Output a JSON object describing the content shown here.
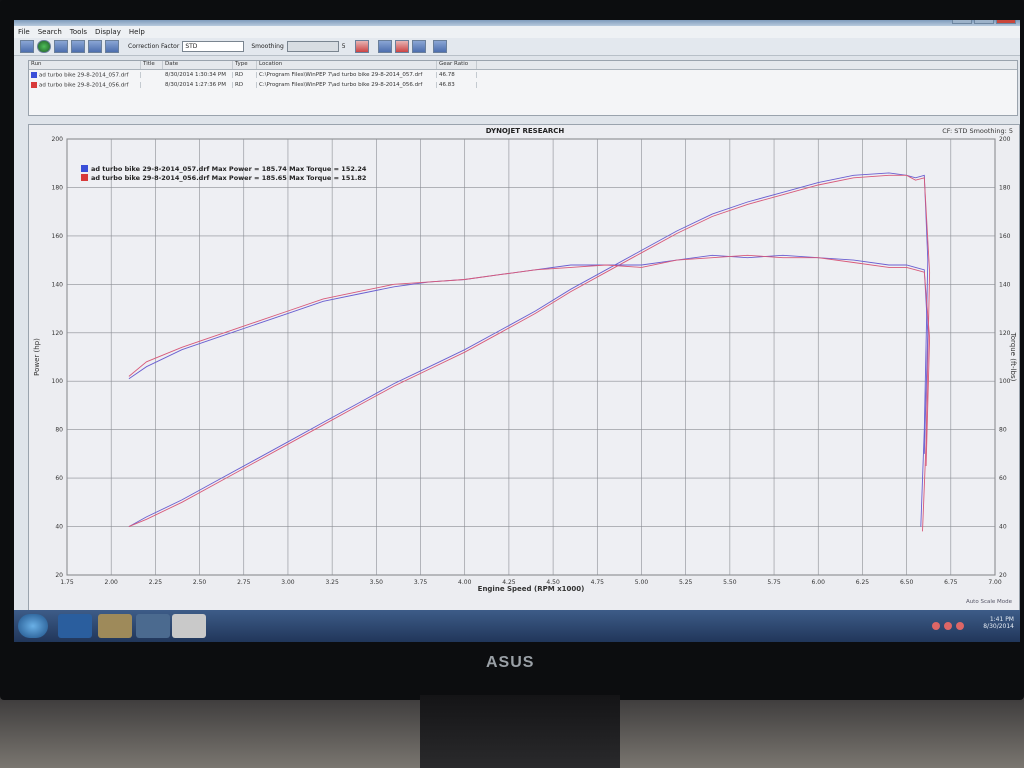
{
  "menu": [
    "File",
    "Search",
    "Tools",
    "Display",
    "Help"
  ],
  "toolbar": {
    "correction_factor_label": "Correction Factor",
    "correction_factor_value": "STD",
    "smoothing_label": "Smoothing",
    "smoothing_value": "5"
  },
  "runs": {
    "columns": [
      "Run",
      "Title",
      "Date",
      "Type",
      "Location",
      "Gear Ratio"
    ],
    "rows": [
      {
        "run": "ad turbo bike 29-8-2014_057.drf",
        "title": "",
        "date": "8/30/2014 1:30:34 PM",
        "type": "RD",
        "location": "C:\\Program Files\\WinPEP 7\\ad turbo bike 29-8-2014_057.drf",
        "gear": "46.78",
        "color": "#3a4fd8"
      },
      {
        "run": "ad turbo bike 29-8-2014_056.drf",
        "title": "",
        "date": "8/30/2014 1:27:36 PM",
        "type": "RD",
        "location": "C:\\Program Files\\WinPEP 7\\ad turbo bike 29-8-2014_056.drf",
        "gear": "46.83",
        "color": "#d83a3a"
      }
    ]
  },
  "chart_header": {
    "title": "DYNOJET RESEARCH",
    "right": "CF: STD  Smoothing: 5",
    "autoscale": "Auto Scale Mode"
  },
  "chart_data": {
    "type": "line",
    "xlabel": "Engine Speed (RPM x1000)",
    "ylabel": "Power (hp)",
    "y2label": "Torque (ft-lbs)",
    "xlim": [
      1.75,
      7.0
    ],
    "ylim": [
      20,
      200
    ],
    "y2lim": [
      20,
      200
    ],
    "xticks": [
      "1.75",
      "2.00",
      "2.25",
      "2.50",
      "2.75",
      "3.00",
      "3.25",
      "3.50",
      "3.75",
      "4.00",
      "4.25",
      "4.50",
      "4.75",
      "5.00",
      "5.25",
      "5.50",
      "5.75",
      "6.00",
      "6.25",
      "6.50",
      "6.75",
      "7.00"
    ],
    "yticks": [
      "20",
      "40",
      "60",
      "80",
      "100",
      "120",
      "140",
      "160",
      "180",
      "200"
    ],
    "grid": true,
    "legend_position": "top-left",
    "legend": [
      {
        "label": "ad turbo bike 29-8-2014_057.drf Max Power = 185.74 Max Torque = 152.24",
        "color": "#3a4fd8"
      },
      {
        "label": "ad turbo bike 29-8-2014_056.drf Max Power = 185.65 Max Torque = 151.82",
        "color": "#d83a3a"
      }
    ],
    "series": [
      {
        "color": "#6a5fd0",
        "x": [
          2.1,
          2.2,
          2.4,
          2.6,
          2.8,
          3.0,
          3.2,
          3.4,
          3.6,
          3.8,
          4.0,
          4.2,
          4.4,
          4.6,
          4.8,
          5.0,
          5.2,
          5.4,
          5.6,
          5.8,
          6.0,
          6.2,
          6.4,
          6.5,
          6.55,
          6.6,
          6.62,
          6.6,
          6.58
        ],
        "y": [
          40,
          44,
          51,
          59,
          67,
          75,
          83,
          91,
          99,
          106,
          113,
          121,
          129,
          138,
          146,
          154,
          162,
          169,
          174,
          178,
          182,
          185,
          186,
          185,
          184,
          185,
          150,
          80,
          40
        ]
      },
      {
        "color": "#d85a7a",
        "x": [
          2.1,
          2.2,
          2.4,
          2.6,
          2.8,
          3.0,
          3.2,
          3.4,
          3.6,
          3.8,
          4.0,
          4.2,
          4.4,
          4.6,
          4.8,
          5.0,
          5.2,
          5.4,
          5.6,
          5.8,
          6.0,
          6.2,
          6.4,
          6.5,
          6.55,
          6.6,
          6.63,
          6.61,
          6.59
        ],
        "y": [
          40,
          43,
          50,
          58,
          66,
          74,
          82,
          90,
          98,
          105,
          112,
          120,
          128,
          137,
          145,
          153,
          161,
          168,
          173,
          177,
          181,
          184,
          185,
          185,
          183,
          184,
          145,
          75,
          38
        ]
      },
      {
        "color": "#6a5fd0",
        "x": [
          2.1,
          2.2,
          2.4,
          2.6,
          2.8,
          3.0,
          3.2,
          3.4,
          3.6,
          3.8,
          4.0,
          4.2,
          4.4,
          4.6,
          4.8,
          5.0,
          5.2,
          5.4,
          5.6,
          5.8,
          6.0,
          6.2,
          6.4,
          6.5,
          6.55,
          6.6,
          6.62,
          6.6
        ],
        "y": [
          101,
          106,
          113,
          118,
          123,
          128,
          133,
          136,
          139,
          141,
          142,
          144,
          146,
          148,
          148,
          148,
          150,
          152,
          151,
          152,
          151,
          150,
          148,
          148,
          147,
          146,
          120,
          70
        ]
      },
      {
        "color": "#d85a7a",
        "x": [
          2.1,
          2.2,
          2.4,
          2.6,
          2.8,
          3.0,
          3.2,
          3.4,
          3.6,
          3.8,
          4.0,
          4.2,
          4.4,
          4.6,
          4.8,
          5.0,
          5.2,
          5.4,
          5.6,
          5.8,
          6.0,
          6.2,
          6.4,
          6.5,
          6.55,
          6.6,
          6.63,
          6.61
        ],
        "y": [
          102,
          108,
          114,
          119,
          124,
          129,
          134,
          137,
          140,
          141,
          142,
          144,
          146,
          147,
          148,
          147,
          150,
          151,
          152,
          151,
          151,
          149,
          147,
          147,
          146,
          145,
          118,
          65
        ]
      }
    ]
  },
  "taskbar": {
    "time": "1:41 PM",
    "date": "8/30/2014"
  },
  "monitor_brand": "ASUS"
}
